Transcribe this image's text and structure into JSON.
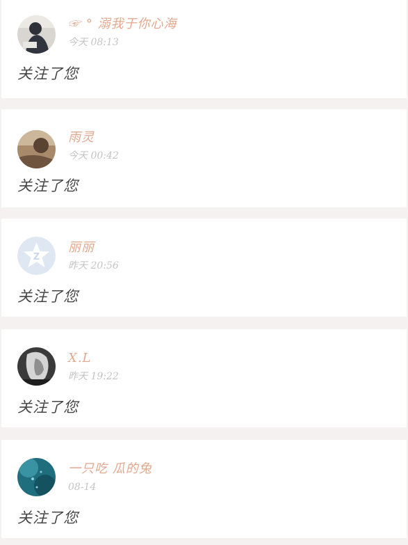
{
  "notifications": [
    {
      "name": "☞ ° 溺我于你心海",
      "time": "今天 08:13",
      "message": "关注了您",
      "avatar_icon": "user-avatar-photo"
    },
    {
      "name": "雨灵",
      "time": "今天 00:42",
      "message": "关注了您",
      "avatar_icon": "user-avatar-photo"
    },
    {
      "name": "丽丽",
      "time": "昨天 20:56",
      "message": "关注了您",
      "avatar_icon": "default-avatar-star-z"
    },
    {
      "name": "X.L",
      "time": "昨天 19:22",
      "message": "关注了您",
      "avatar_icon": "user-avatar-photo"
    },
    {
      "name": "一只吃 瓜的兔",
      "time": "08-14",
      "message": "关注了您",
      "avatar_icon": "user-avatar-photo"
    }
  ],
  "colors": {
    "background": "#f5f1f1",
    "card": "#ffffff",
    "name": "#e3a88d",
    "time": "#c4c4c4",
    "message": "#444444"
  }
}
